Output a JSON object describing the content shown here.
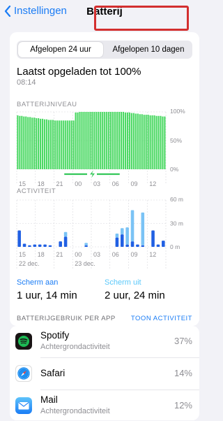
{
  "nav": {
    "back_label": "Instellingen",
    "title": "Batterij"
  },
  "segment": {
    "option1": "Afgelopen 24 uur",
    "option2": "Afgelopen 10 dagen",
    "selected": "Afgelopen 24 uur"
  },
  "charge": {
    "title": "Laatst opgeladen tot 100%",
    "time": "08:14"
  },
  "battery_chart_label": "BATTERIJNIVEAU",
  "activity_chart_label": "ACTIVITEIT",
  "chart_data": [
    {
      "type": "area",
      "title": "BATTERIJNIVEAU",
      "x_ticks": [
        "15",
        "18",
        "21",
        "00",
        "03",
        "06",
        "09",
        "12"
      ],
      "y_ticks": [
        "100%",
        "50%",
        "0%"
      ],
      "ylim": [
        0,
        100
      ],
      "values": [
        94,
        93,
        93,
        92,
        92,
        91,
        91,
        90,
        90,
        89,
        89,
        88,
        88,
        87,
        87,
        86,
        86,
        86,
        85,
        85,
        85,
        85,
        85,
        85,
        85,
        85,
        85,
        85,
        99,
        99,
        100,
        100,
        100,
        100,
        100,
        100,
        100,
        100,
        100,
        100,
        100,
        100,
        100,
        100,
        100,
        100,
        100,
        100,
        100,
        100,
        100,
        100,
        99,
        99,
        99,
        98,
        98,
        97,
        97,
        96,
        96,
        95,
        95,
        95,
        94,
        94,
        94,
        93,
        93,
        93,
        92,
        92
      ],
      "charging_period": [
        "00",
        "06"
      ],
      "grid": true,
      "color": "#4cd964"
    },
    {
      "type": "bar",
      "title": "ACTIVITEIT",
      "x_ticks": [
        "15",
        "18",
        "21",
        "00",
        "03",
        "06",
        "09",
        "12"
      ],
      "date_labels": [
        "22 dec.",
        "23 dec."
      ],
      "y_ticks": [
        "60 m",
        "30 m",
        "0 m"
      ],
      "ylim": [
        0,
        60
      ],
      "series": [
        {
          "name": "Scherm aan",
          "color": "#2160e3",
          "values": [
            21,
            4,
            2,
            3,
            3,
            3,
            2,
            0,
            7,
            13,
            0,
            0,
            0,
            2,
            0,
            0,
            0,
            0,
            0,
            12,
            16,
            3,
            7,
            3,
            2,
            0,
            21,
            3,
            8
          ]
        },
        {
          "name": "Scherm uit",
          "color": "#7ac3f5",
          "values": [
            0,
            0,
            0,
            0,
            0,
            0,
            0,
            0,
            0,
            6,
            0,
            0,
            0,
            3,
            0,
            0,
            0,
            0,
            0,
            5,
            8,
            22,
            40,
            0,
            42,
            0,
            0,
            0,
            0
          ]
        }
      ],
      "grid": true
    }
  ],
  "screen": {
    "on_label": "Scherm aan",
    "on_value": "1 uur, 14 min",
    "off_label": "Scherm uit",
    "off_value": "2 uur, 24 min",
    "on_color": "#1a7cf5",
    "off_color": "#5ac8fa"
  },
  "usage": {
    "header": "BATTERIJGEBRUIK PER APP",
    "toggle": "TOON ACTIVITEIT"
  },
  "apps": [
    {
      "name": "Spotify",
      "sub": "Achtergrondactiviteit",
      "pct": "37%",
      "icon": "spotify-icon"
    },
    {
      "name": "Safari",
      "sub": "",
      "pct": "14%",
      "icon": "safari-icon"
    },
    {
      "name": "Mail",
      "sub": "Achtergrondactiviteit",
      "pct": "12%",
      "icon": "mail-icon"
    }
  ]
}
